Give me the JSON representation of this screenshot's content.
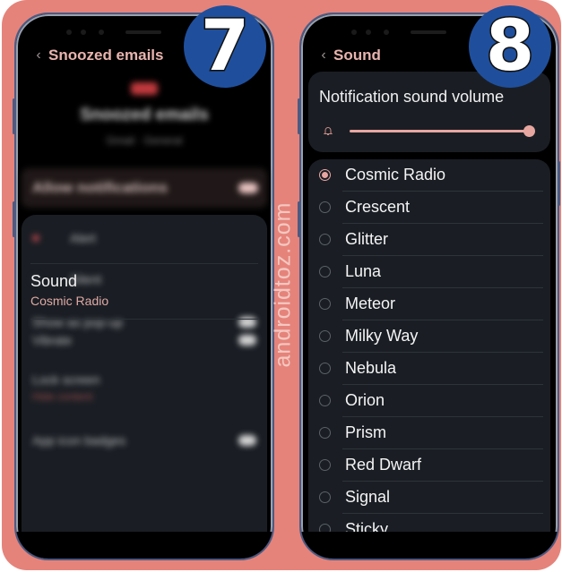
{
  "colors": {
    "background": "#e5837a",
    "accent": "#e8a6a0",
    "badge": "#1f4f9c",
    "panel": "#1a1e24"
  },
  "watermark": "androidtoz.com",
  "steps": [
    {
      "badge": "7",
      "app_bar": {
        "back_icon": "chevron-left-icon",
        "title": "Snoozed emails"
      },
      "header": {
        "title": "Snoozed emails",
        "subtitle": "Gmail · General"
      },
      "allow_notifications": {
        "label": "Allow notifications",
        "enabled": true
      },
      "options": [
        {
          "label": "Alert",
          "selected": true
        },
        {
          "label": "Silent",
          "selected": false
        }
      ],
      "settings": [
        {
          "label": "Show as pop-up",
          "type": "toggle"
        },
        {
          "label": "Sound",
          "value": "Cosmic Radio",
          "type": "link"
        },
        {
          "label": "Vibrate",
          "type": "toggle"
        },
        {
          "label": "Lock screen",
          "value": "Hide content",
          "type": "link"
        },
        {
          "label": "App icon badges",
          "type": "toggle"
        }
      ]
    },
    {
      "badge": "8",
      "app_bar": {
        "back_icon": "chevron-left-icon",
        "title": "Sound"
      },
      "volume": {
        "title": "Notification sound volume",
        "icon": "bell-icon",
        "level_percent": 100
      },
      "selected_tone": "Cosmic Radio",
      "tones": [
        "Cosmic Radio",
        "Crescent",
        "Glitter",
        "Luna",
        "Meteor",
        "Milky Way",
        "Nebula",
        "Orion",
        "Prism",
        "Red Dwarf",
        "Signal",
        "Sticky"
      ]
    }
  ]
}
